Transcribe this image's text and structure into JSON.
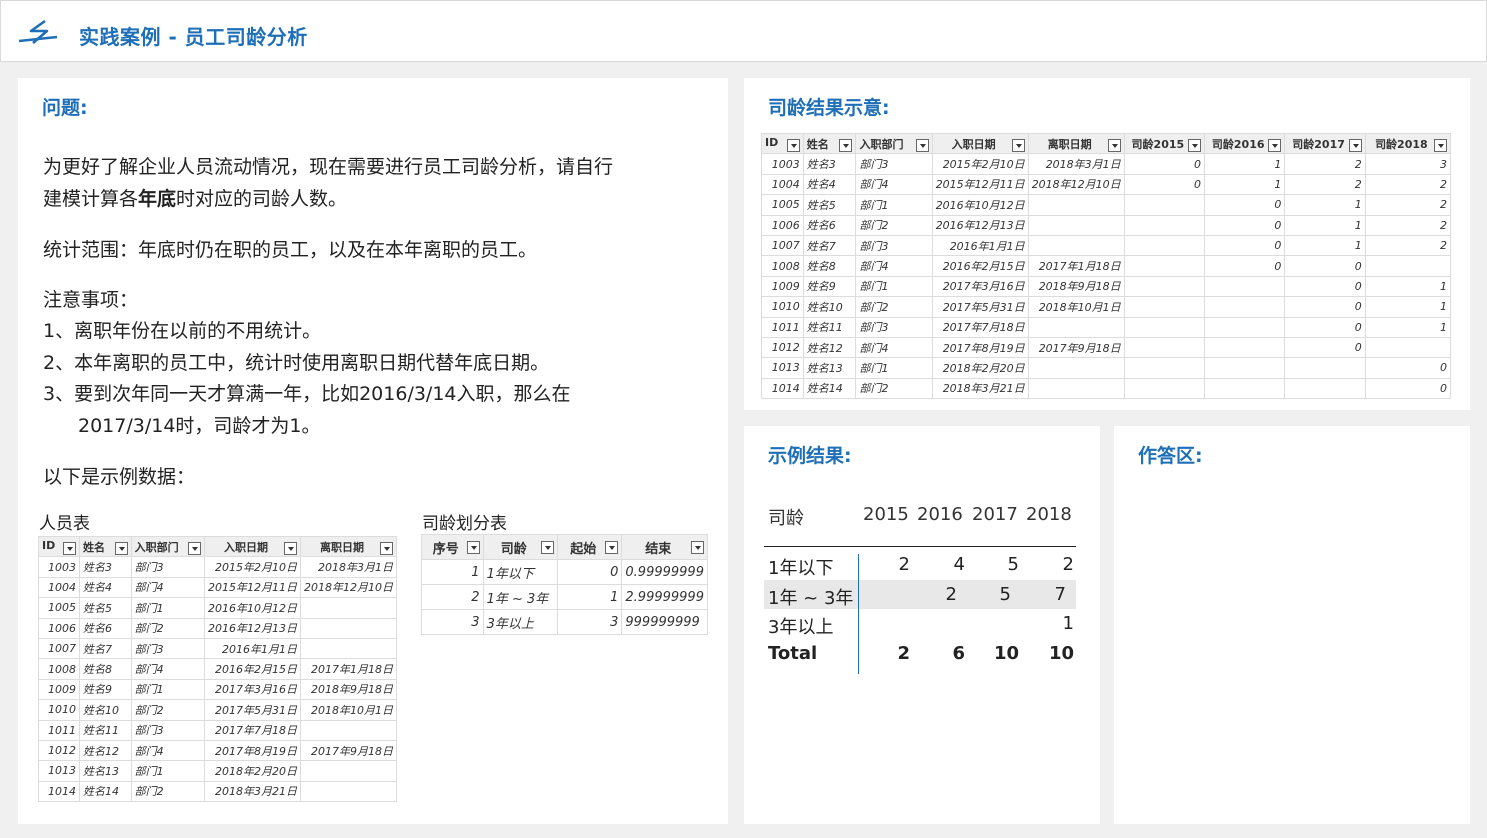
{
  "header": {
    "title": "实践案例 - 员工司龄分析"
  },
  "question": {
    "title": "问题:",
    "para1_a": "为更好了解企业人员流动情况，现在需要进行员工司龄分析，请自行",
    "para1_b_pre": "建模计算各",
    "para1_b_bold": "年底",
    "para1_b_post": "时对应的司龄人数。",
    "scope": "统计范围：年底时仍在职的员工，以及在本年离职的员工。",
    "notes_title": "注意事项：",
    "note1": "1、离职年份在以前的不用统计。",
    "note2": "2、本年离职的员工中，统计时使用离职日期代替年底日期。",
    "note3_a": "3、要到次年同一天才算满一年，比如2016/3/14入职，那么在",
    "note3_b": "2017/3/14时，司龄才为1。",
    "sample_intro": "以下是示例数据："
  },
  "staff_table": {
    "caption": "人员表",
    "headers": [
      "ID",
      "姓名",
      "入职部门",
      "入职日期",
      "离职日期"
    ],
    "rows": [
      [
        "1003",
        "姓名3",
        "部门3",
        "2015年2月10日",
        "2018年3月1日"
      ],
      [
        "1004",
        "姓名4",
        "部门4",
        "2015年12月11日",
        "2018年12月10日"
      ],
      [
        "1005",
        "姓名5",
        "部门1",
        "2016年10月12日",
        ""
      ],
      [
        "1006",
        "姓名6",
        "部门2",
        "2016年12月13日",
        ""
      ],
      [
        "1007",
        "姓名7",
        "部门3",
        "2016年1月1日",
        ""
      ],
      [
        "1008",
        "姓名8",
        "部门4",
        "2016年2月15日",
        "2017年1月18日"
      ],
      [
        "1009",
        "姓名9",
        "部门1",
        "2017年3月16日",
        "2018年9月18日"
      ],
      [
        "1010",
        "姓名10",
        "部门2",
        "2017年5月31日",
        "2018年10月1日"
      ],
      [
        "1011",
        "姓名11",
        "部门3",
        "2017年7月18日",
        ""
      ],
      [
        "1012",
        "姓名12",
        "部门4",
        "2017年8月19日",
        "2017年9月18日"
      ],
      [
        "1013",
        "姓名13",
        "部门1",
        "2018年2月20日",
        ""
      ],
      [
        "1014",
        "姓名14",
        "部门2",
        "2018年3月21日",
        ""
      ]
    ]
  },
  "tenure_table": {
    "caption": "司龄划分表",
    "headers": [
      "序号",
      "司龄",
      "起始",
      "结束"
    ],
    "rows": [
      [
        "1",
        "1年以下",
        "0",
        "0.99999999"
      ],
      [
        "2",
        "1年 ~ 3年",
        "1",
        "2.99999999"
      ],
      [
        "3",
        "3年以上",
        "3",
        "999999999"
      ]
    ]
  },
  "result_view": {
    "title": "司龄结果示意:",
    "headers": [
      "ID",
      "姓名",
      "入职部门",
      "入职日期",
      "离职日期",
      "司龄2015",
      "司龄2016",
      "司龄2017",
      "司龄2018"
    ],
    "rows": [
      [
        "1003",
        "姓名3",
        "部门3",
        "2015年2月10日",
        "2018年3月1日",
        "0",
        "1",
        "2",
        "3"
      ],
      [
        "1004",
        "姓名4",
        "部门4",
        "2015年12月11日",
        "2018年12月10日",
        "0",
        "1",
        "2",
        "2"
      ],
      [
        "1005",
        "姓名5",
        "部门1",
        "2016年10月12日",
        "",
        "",
        "0",
        "1",
        "2"
      ],
      [
        "1006",
        "姓名6",
        "部门2",
        "2016年12月13日",
        "",
        "",
        "0",
        "1",
        "2"
      ],
      [
        "1007",
        "姓名7",
        "部门3",
        "2016年1月1日",
        "",
        "",
        "0",
        "1",
        "2"
      ],
      [
        "1008",
        "姓名8",
        "部门4",
        "2016年2月15日",
        "2017年1月18日",
        "",
        "0",
        "0",
        ""
      ],
      [
        "1009",
        "姓名9",
        "部门1",
        "2017年3月16日",
        "2018年9月18日",
        "",
        "",
        "0",
        "1"
      ],
      [
        "1010",
        "姓名10",
        "部门2",
        "2017年5月31日",
        "2018年10月1日",
        "",
        "",
        "0",
        "1"
      ],
      [
        "1011",
        "姓名11",
        "部门3",
        "2017年7月18日",
        "",
        "",
        "",
        "0",
        "1"
      ],
      [
        "1012",
        "姓名12",
        "部门4",
        "2017年8月19日",
        "2017年9月18日",
        "",
        "",
        "0",
        ""
      ],
      [
        "1013",
        "姓名13",
        "部门1",
        "2018年2月20日",
        "",
        "",
        "",
        "",
        "0"
      ],
      [
        "1014",
        "姓名14",
        "部门2",
        "2018年3月21日",
        "",
        "",
        "",
        "",
        "0"
      ]
    ]
  },
  "sample_result": {
    "title": "示例结果:",
    "row_header": "司龄",
    "columns": [
      "2015",
      "2016",
      "2017",
      "2018"
    ],
    "rows": [
      {
        "label": "1年以下",
        "values": [
          "2",
          "4",
          "5",
          "2"
        ]
      },
      {
        "label": "1年 ~ 3年",
        "values": [
          "",
          "2",
          "5",
          "7"
        ]
      },
      {
        "label": "3年以上",
        "values": [
          "",
          "",
          "",
          "1"
        ]
      }
    ],
    "total": {
      "label": "Total",
      "values": [
        "2",
        "6",
        "10",
        "10"
      ]
    }
  },
  "answer": {
    "title": "作答区:"
  },
  "colors": {
    "accent": "#1f6fb8",
    "header_bg": "#efefef",
    "row_alt": "#e8e8e8"
  }
}
